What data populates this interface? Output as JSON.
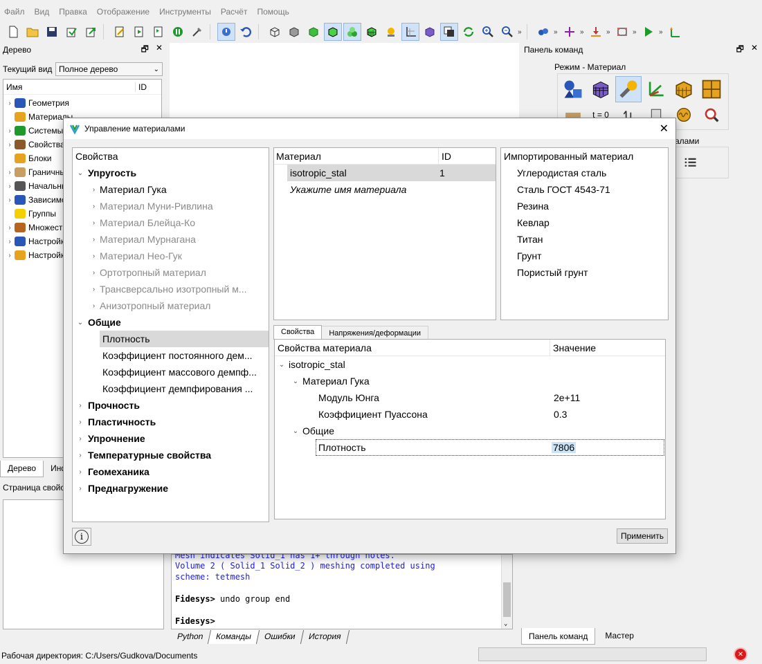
{
  "menu": [
    "Файл",
    "Вид",
    "Правка",
    "Отображение",
    "Инструменты",
    "Расчёт",
    "Помощь"
  ],
  "tree_panel": {
    "title": "Дерево",
    "current_view_label": "Текущий вид",
    "current_view_value": "Полное дерево",
    "col_name": "Имя",
    "col_id": "ID",
    "items": [
      "Геометрия",
      "Материалы",
      "Системы координат",
      "Свойства",
      "Блоки",
      "Граничные условия",
      "Начальные условия",
      "Зависимости",
      "Группы",
      "Множества",
      "Настройки",
      "Настройки"
    ],
    "tabs": [
      "Дерево",
      "Информация"
    ],
    "properties_title": "Страница свойств"
  },
  "cmd_panel": {
    "title": "Панель команд",
    "mode_label": "Режим - Материал",
    "t0_label": "t = 0",
    "group2_label": "алами",
    "tabs": [
      "Панель команд",
      "Мастер"
    ]
  },
  "dialog": {
    "title": "Управление материалами",
    "props_header": "Свойства",
    "groups": [
      {
        "label": "Упругость",
        "expanded": true,
        "children": [
          {
            "label": "Материал Гука",
            "enabled": true
          },
          {
            "label": "Материал Муни-Ривлина",
            "enabled": false
          },
          {
            "label": "Материал Блейца-Ко",
            "enabled": false
          },
          {
            "label": "Материал Мурнагана",
            "enabled": false
          },
          {
            "label": "Материал Нео-Гук",
            "enabled": false
          },
          {
            "label": "Ортотропный материал",
            "enabled": false
          },
          {
            "label": "Трансверсально изотропный м...",
            "enabled": false
          },
          {
            "label": "Анизотропный материал",
            "enabled": false
          }
        ]
      },
      {
        "label": "Общие",
        "expanded": true,
        "children": [
          {
            "label": "Плотность",
            "enabled": true,
            "selected": true
          },
          {
            "label": "Коэффициент постоянного дем...",
            "enabled": true
          },
          {
            "label": "Коэффициент массового демпф...",
            "enabled": true
          },
          {
            "label": "Коэффициент демпфирования ...",
            "enabled": true
          }
        ]
      },
      {
        "label": "Прочность",
        "expanded": false,
        "children": []
      },
      {
        "label": "Пластичность",
        "expanded": false,
        "children": []
      },
      {
        "label": "Упрочнение",
        "expanded": false,
        "children": []
      },
      {
        "label": "Температурные свойства",
        "expanded": false,
        "children": []
      },
      {
        "label": "Геомеханика",
        "expanded": false,
        "children": []
      },
      {
        "label": "Преднагружение",
        "expanded": false,
        "children": []
      }
    ],
    "materials": {
      "col_material": "Материал",
      "col_id": "ID",
      "rows": [
        {
          "name": "isotropic_stal",
          "id": "1"
        }
      ],
      "placeholder": "Укажите имя материала"
    },
    "imported": {
      "header": "Импортированный материал",
      "items": [
        "Углеродистая сталь",
        "Сталь ГОСТ 4543-71",
        "Резина",
        "Кевлар",
        "Титан",
        "Грунт",
        "Пористый грунт"
      ]
    },
    "tabs": [
      "Свойства",
      "Напряжения/деформации"
    ],
    "grid": {
      "col_prop": "Свойства материала",
      "col_value": "Значение",
      "root": "isotropic_stal",
      "hooke": "Материал Гука",
      "young_label": "Модуль Юнга",
      "young_value": "2e+11",
      "poisson_label": "Коэффициент Пуассона",
      "poisson_value": "0.3",
      "general": "Общие",
      "density_label": "Плотность",
      "density_value": "7806"
    },
    "apply_label": "Применить",
    "info_glyph": "i"
  },
  "console": {
    "line1": "Mesh indicates Solid_1 has 1+ through holes.",
    "line2": "Volume 2 ( Solid_1 Solid_2 ) meshing completed using",
    "line3": "scheme: tetmesh",
    "prompt1": "Fidesys>",
    "cmd1": " undo group end",
    "prompt2": "Fidesys>",
    "tabs": [
      "Python",
      "Команды",
      "Ошибки",
      "История"
    ]
  },
  "status": {
    "workdir": "Рабочая директория: C:/Users/Gudkova/Documents"
  },
  "colors": {
    "selection": "#d9d9d9",
    "value_highlight": "#cce4f7",
    "console_blue": "#1a1aff"
  }
}
